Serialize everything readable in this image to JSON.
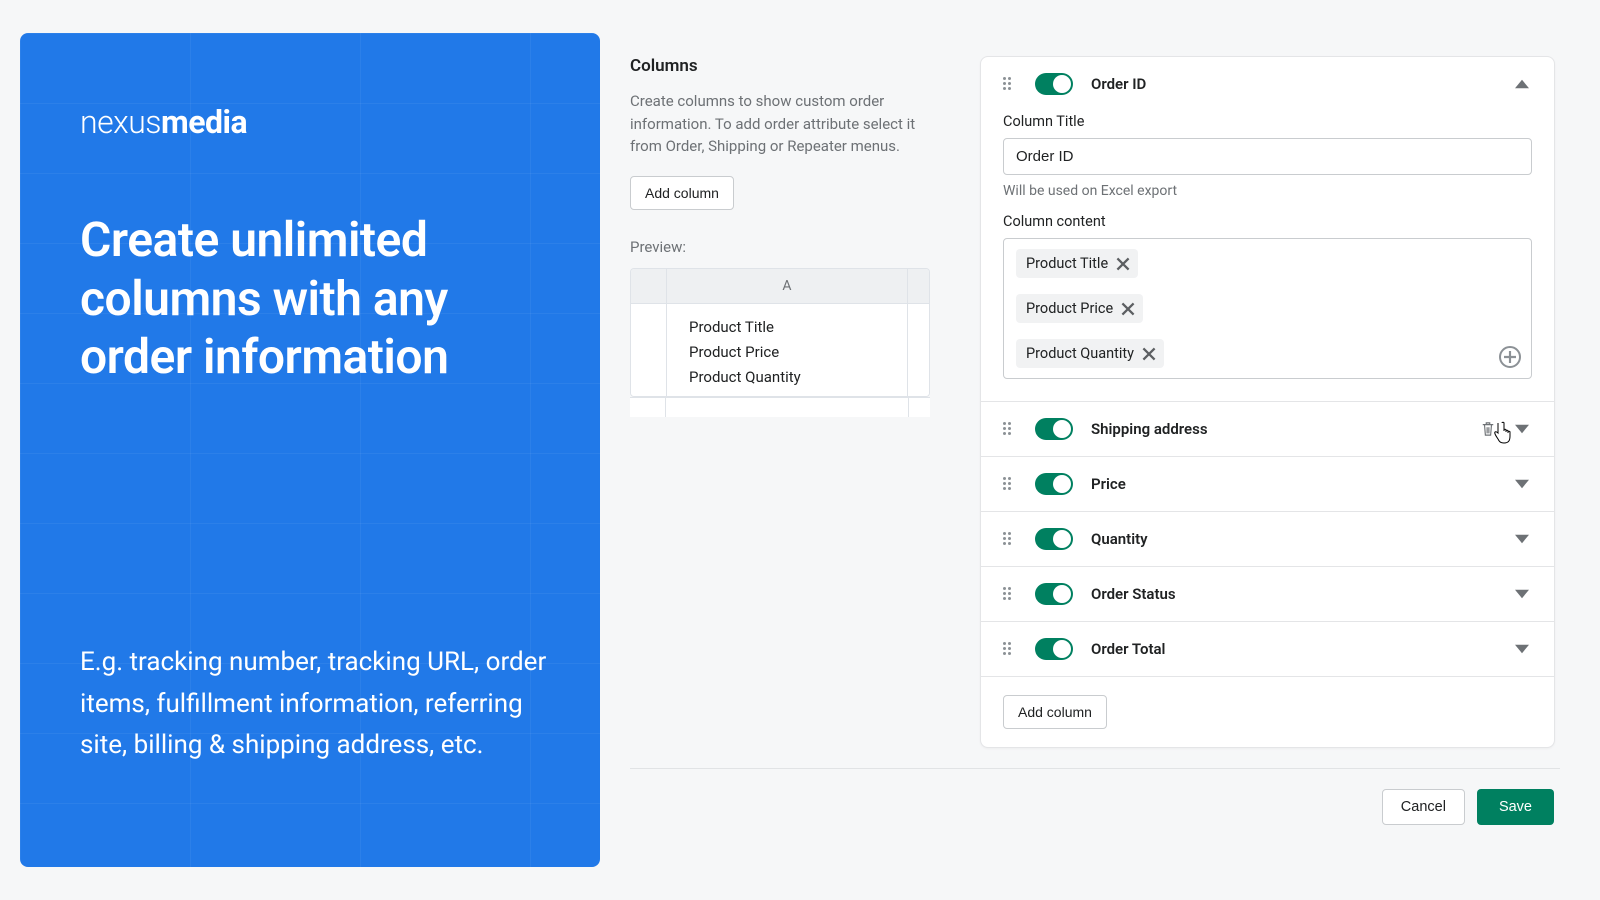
{
  "promo": {
    "brand_light": "nexus",
    "brand_bold": "media",
    "headline": "Create unlimited columns with any order information",
    "sub": "E.g. tracking number, tracking URL, order items, fulfillment information, referring site, billing & shipping address, etc."
  },
  "columns_panel": {
    "title": "Columns",
    "description": "Create columns to show custom order information. To add order attribute select it from Order, Shipping or Repeater menus.",
    "add_button": "Add column",
    "preview_label": "Preview:",
    "preview_header": "A",
    "preview_rows": [
      "Product Title",
      "Product Price",
      "Product Quantity"
    ]
  },
  "editor": {
    "expanded": {
      "name": "Order ID",
      "column_title_label": "Column Title",
      "column_title_value": "Order ID",
      "column_title_hint": "Will be used on Excel export",
      "column_content_label": "Column content",
      "tags": [
        "Product Title",
        "Product Price",
        "Product Quantity"
      ]
    },
    "rows": [
      {
        "name": "Shipping address",
        "has_trash": true
      },
      {
        "name": "Price",
        "has_trash": false
      },
      {
        "name": "Quantity",
        "has_trash": false
      },
      {
        "name": "Order Status",
        "has_trash": false
      },
      {
        "name": "Order Total",
        "has_trash": false
      }
    ],
    "footer_add": "Add column"
  },
  "footer": {
    "cancel": "Cancel",
    "save": "Save"
  },
  "colors": {
    "brand_blue": "#2179e8",
    "primary_green": "#008060"
  }
}
